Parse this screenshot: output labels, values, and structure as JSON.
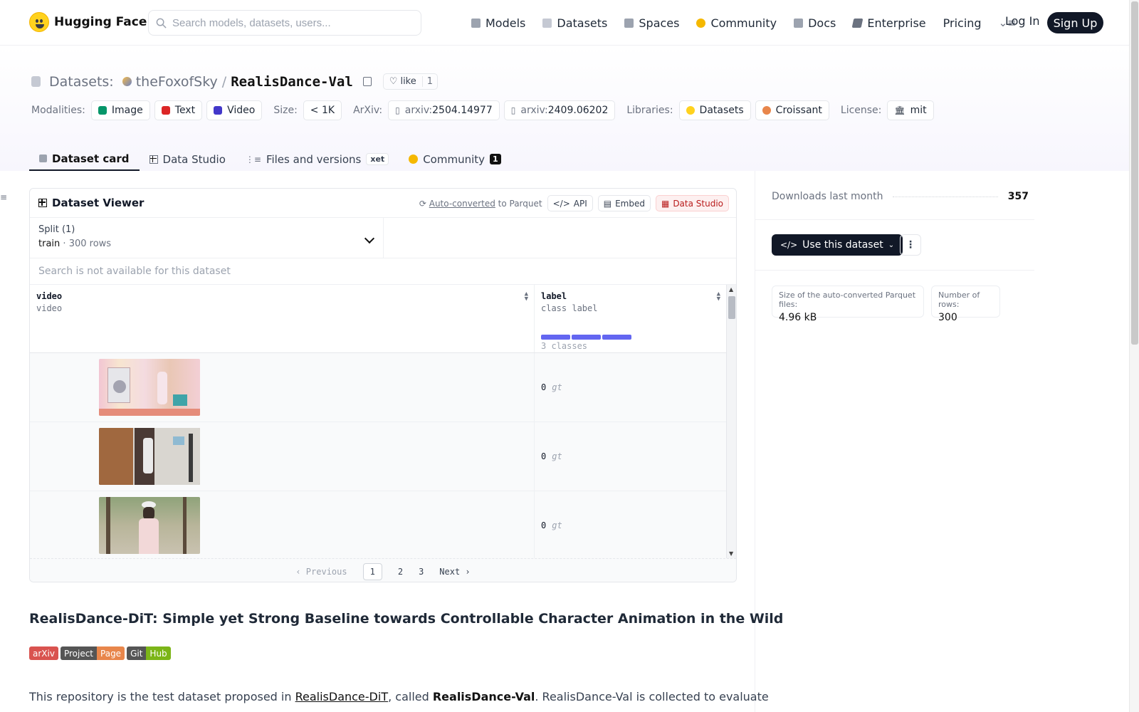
{
  "brand": {
    "name": "Hugging Face"
  },
  "search": {
    "placeholder": "Search models, datasets, users..."
  },
  "nav": {
    "items": [
      {
        "label": "Models",
        "icon": "models-icon",
        "color": "#9ca3af"
      },
      {
        "label": "Datasets",
        "icon": "datasets-icon",
        "color": "#c5c9d3"
      },
      {
        "label": "Spaces",
        "icon": "spaces-icon",
        "color": "#9ca3af"
      },
      {
        "label": "Community",
        "icon": "community-icon",
        "color": "#f5b800"
      },
      {
        "label": "Docs",
        "icon": "docs-icon",
        "color": "#9ca3af"
      },
      {
        "label": "Enterprise",
        "icon": "enterprise-icon",
        "color": "#6b7280"
      },
      {
        "label": "Pricing"
      }
    ],
    "login": "Log In",
    "signup": "Sign Up"
  },
  "repo": {
    "type_label": "Datasets:",
    "owner": "theFoxofSky",
    "separator": "/",
    "name": "RealisDance-Val",
    "like_label": "like",
    "like_count": "1"
  },
  "meta": {
    "modalities_label": "Modalities:",
    "modalities": [
      {
        "label": "Image",
        "color": "#059669"
      },
      {
        "label": "Text",
        "color": "#dc2626"
      },
      {
        "label": "Video",
        "color": "#4338ca"
      }
    ],
    "size_label": "Size:",
    "size": "< 1K",
    "arxiv_label": "ArXiv:",
    "arxiv": [
      {
        "prefix": "arxiv:",
        "id": "2504.14977"
      },
      {
        "prefix": "arxiv:",
        "id": "2409.06202"
      }
    ],
    "libraries_label": "Libraries:",
    "libraries": [
      {
        "label": "Datasets",
        "color": "#ffd21e"
      },
      {
        "label": "Croissant",
        "color": "#e8864b"
      }
    ],
    "license_label": "License:",
    "license": "mit"
  },
  "tabs": [
    {
      "label": "Dataset card",
      "active": true
    },
    {
      "label": "Data Studio"
    },
    {
      "label": "Files and versions",
      "badge": "xet"
    },
    {
      "label": "Community",
      "count": "1"
    }
  ],
  "viewer": {
    "title": "Dataset Viewer",
    "auto_converted": "Auto-converted",
    "to_parquet": " to Parquet",
    "api": "API",
    "embed": "Embed",
    "data_studio": "Data Studio",
    "split_label": "Split (1)",
    "split_name": "train",
    "split_dot": "·",
    "split_rows": "300 rows",
    "search_disabled": "Search is not available for this dataset",
    "columns": [
      {
        "name": "video",
        "type": "video"
      },
      {
        "name": "label",
        "type": "class label",
        "classes": "3 classes"
      }
    ],
    "rows": [
      {
        "label": "0",
        "class": "gt"
      },
      {
        "label": "0",
        "class": "gt"
      },
      {
        "label": "0",
        "class": "gt"
      }
    ],
    "pager": {
      "previous": "Previous",
      "pages": [
        "1",
        "2",
        "3"
      ],
      "next": "Next",
      "current": "1"
    }
  },
  "card": {
    "title": "RealisDance-DiT: Simple yet Strong Baseline towards Controllable Character Animation in the Wild",
    "badges": [
      {
        "left": "arXiv",
        "right": "",
        "left_color": "#d9534f",
        "right_color": ""
      },
      {
        "left": "Project",
        "right": "Page",
        "left_color": "#555555",
        "right_color": "#e8864b"
      },
      {
        "left": "Git",
        "right": "Hub",
        "left_color": "#555555",
        "right_color": "#7cb518"
      }
    ],
    "para_start": "This repository is the test dataset proposed in ",
    "para_link": "RealisDance-DiT",
    "para_mid": ", called ",
    "para_bold": "RealisDance-Val",
    "para_end": ". RealisDance-Val is collected to evaluate"
  },
  "side": {
    "downloads_label": "Downloads last month",
    "downloads": "357",
    "use_dataset": "Use this dataset",
    "parquet_size_label": "Size of the auto-converted Parquet files:",
    "parquet_size": "4.96 kB",
    "num_rows_label": "Number of rows:",
    "num_rows": "300"
  }
}
